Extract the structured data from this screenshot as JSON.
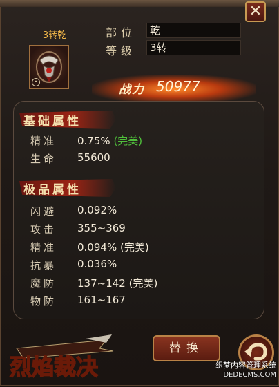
{
  "item": {
    "level_title": "3转乾",
    "slot_label": "部位",
    "slot_value": "乾",
    "level_label": "等级",
    "level_value": "3转"
  },
  "power": {
    "label": "战力",
    "value": "50977"
  },
  "base_section": {
    "title": "基础属性",
    "stats": [
      {
        "name": "精准",
        "value": "0.75%",
        "note": "(完美)"
      },
      {
        "name": "生命",
        "value": "55600",
        "note": ""
      }
    ]
  },
  "extra_section": {
    "title": "极品属性",
    "stats": [
      {
        "name": "闪避",
        "value": "0.092%"
      },
      {
        "name": "攻击",
        "value": "355~369"
      },
      {
        "name": "精准",
        "value": "0.094% (完美)"
      },
      {
        "name": "抗暴",
        "value": "0.036%"
      },
      {
        "name": "魔防",
        "value": "137~142 (完美)"
      },
      {
        "name": "物防",
        "value": "161~167"
      }
    ]
  },
  "buttons": {
    "close": "✕",
    "replace": "替换",
    "back": "↶"
  },
  "logo": {
    "text": "烈焰裁决"
  },
  "watermark": {
    "line1": "织梦内容管理系统",
    "line2": "DEDECMS.COM"
  },
  "colors": {
    "accent_gold": "#f2b84a",
    "perfect_green": "#4fbf3b",
    "ribbon_red": "#9b2414"
  }
}
